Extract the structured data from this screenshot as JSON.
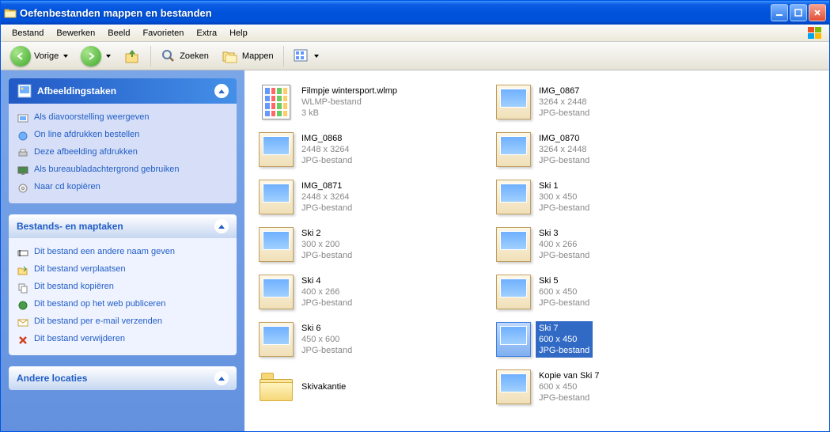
{
  "window": {
    "title": "Oefenbestanden mappen en bestanden"
  },
  "menu": [
    "Bestand",
    "Bewerken",
    "Beeld",
    "Favorieten",
    "Extra",
    "Help"
  ],
  "toolbar": {
    "back": "Vorige",
    "search": "Zoeken",
    "folders": "Mappen"
  },
  "sidebar": {
    "image_tasks": {
      "title": "Afbeeldingstaken",
      "items": [
        "Als diavoorstelling weergeven",
        "On line afdrukken bestellen",
        "Deze afbeelding afdrukken",
        "Als bureaubladachtergrond gebruiken",
        "Naar cd kopiëren"
      ]
    },
    "file_tasks": {
      "title": "Bestands- en maptaken",
      "items": [
        "Dit bestand een andere naam geven",
        "Dit bestand verplaatsen",
        "Dit bestand kopiëren",
        "Dit bestand op het web publiceren",
        "Dit bestand per e-mail verzenden",
        "Dit bestand verwijderen"
      ]
    },
    "other": {
      "title": "Andere locaties"
    }
  },
  "files": [
    {
      "name": "Filmpje wintersport.wlmp",
      "line2": "WLMP-bestand",
      "line3": "3 kB",
      "type": "doc",
      "selected": false
    },
    {
      "name": "IMG_0867",
      "line2": "3264 x 2448",
      "line3": "JPG-bestand",
      "type": "img",
      "selected": false
    },
    {
      "name": "IMG_0868",
      "line2": "2448 x 3264",
      "line3": "JPG-bestand",
      "type": "img",
      "selected": false
    },
    {
      "name": "IMG_0870",
      "line2": "3264 x 2448",
      "line3": "JPG-bestand",
      "type": "img",
      "selected": false
    },
    {
      "name": "IMG_0871",
      "line2": "2448 x 3264",
      "line3": "JPG-bestand",
      "type": "img",
      "selected": false
    },
    {
      "name": "Ski 1",
      "line2": "300 x 450",
      "line3": "JPG-bestand",
      "type": "img",
      "selected": false
    },
    {
      "name": "Ski 2",
      "line2": "300 x 200",
      "line3": "JPG-bestand",
      "type": "img",
      "selected": false
    },
    {
      "name": "Ski 3",
      "line2": "400 x 266",
      "line3": "JPG-bestand",
      "type": "img",
      "selected": false
    },
    {
      "name": "Ski 4",
      "line2": "400 x 266",
      "line3": "JPG-bestand",
      "type": "img",
      "selected": false
    },
    {
      "name": "Ski 5",
      "line2": "600 x 450",
      "line3": "JPG-bestand",
      "type": "img",
      "selected": false
    },
    {
      "name": "Ski 6",
      "line2": "450 x 600",
      "line3": "JPG-bestand",
      "type": "img",
      "selected": false
    },
    {
      "name": "Ski 7",
      "line2": "600 x 450",
      "line3": "JPG-bestand",
      "type": "img",
      "selected": true
    },
    {
      "name": "Skivakantie",
      "line2": "",
      "line3": "",
      "type": "folder",
      "selected": false
    },
    {
      "name": "Kopie van Ski 7",
      "line2": "600 x 450",
      "line3": "JPG-bestand",
      "type": "img",
      "selected": false
    }
  ]
}
